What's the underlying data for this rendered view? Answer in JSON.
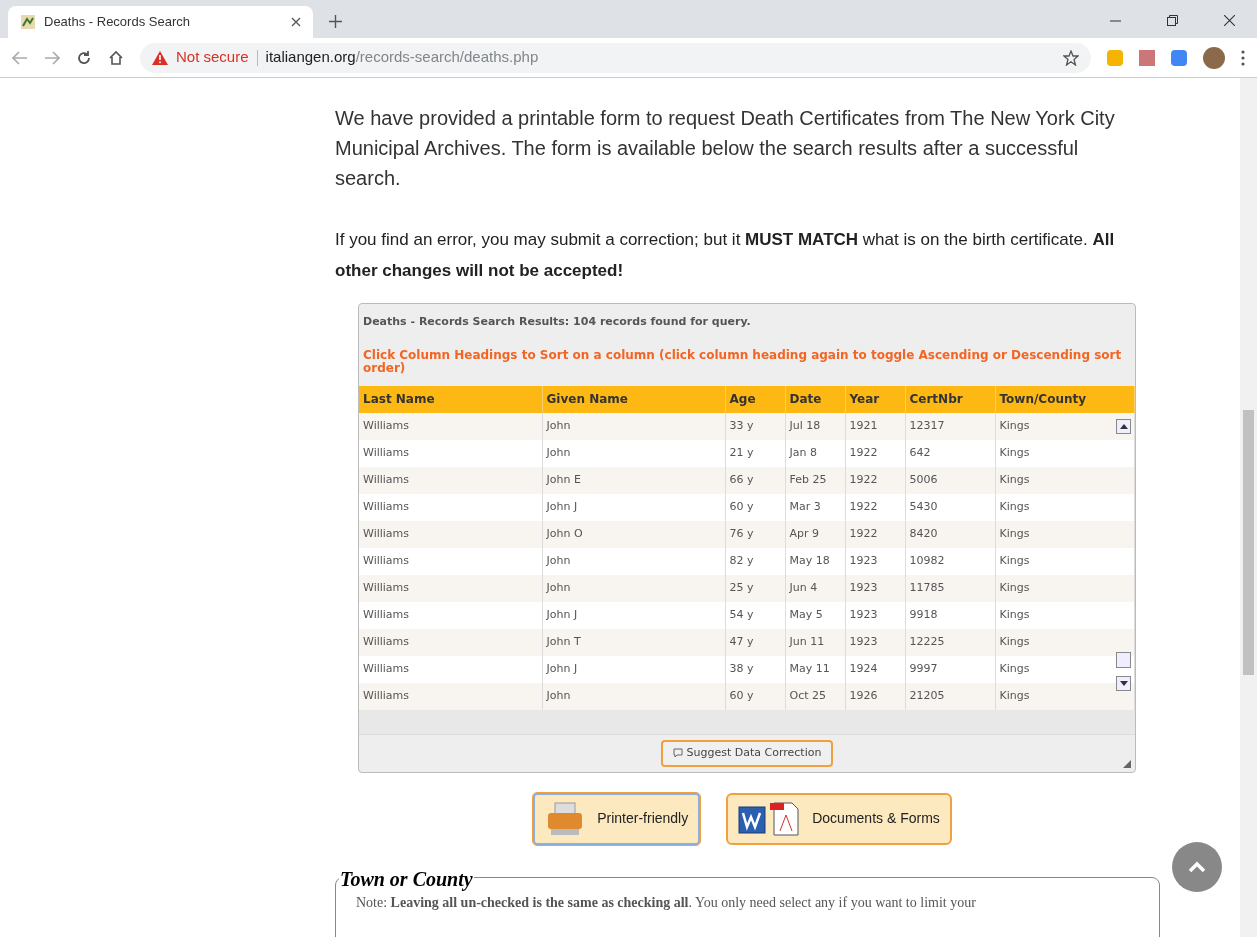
{
  "browser": {
    "tab_title": "Deaths - Records Search",
    "security": "Not secure",
    "url_host": "italiangen.org",
    "url_path": "/records-search/deaths.php"
  },
  "intro": "We have provided a printable form to request Death Certificates from The New York City Municipal Archives. The form is available below the search results after a successful search.",
  "notice": "If you find an error, you may submit a correction; but it **MUST MATCH** what is on the birth certificate. **All other changes will not be accepted!**",
  "results": {
    "summary": "Deaths - Records Search Results: 104 records found for query.",
    "hint": "Click Column Headings to Sort on a column (click column heading again to toggle Ascending or Descending sort order)",
    "columns": [
      "Last Name",
      "Given Name",
      "Age",
      "Date",
      "Year",
      "CertNbr",
      "Town/County"
    ],
    "rows": [
      [
        "Williams",
        "John",
        "33 y",
        "Jul 18",
        "1921",
        "12317",
        "Kings"
      ],
      [
        "Williams",
        "John",
        "21 y",
        "Jan 8",
        "1922",
        "642",
        "Kings"
      ],
      [
        "Williams",
        "John E",
        "66 y",
        "Feb 25",
        "1922",
        "5006",
        "Kings"
      ],
      [
        "Williams",
        "John J",
        "60 y",
        "Mar 3",
        "1922",
        "5430",
        "Kings"
      ],
      [
        "Williams",
        "John O",
        "76 y",
        "Apr 9",
        "1922",
        "8420",
        "Kings"
      ],
      [
        "Williams",
        "John",
        "82 y",
        "May 18",
        "1923",
        "10982",
        "Kings"
      ],
      [
        "Williams",
        "John",
        "25 y",
        "Jun 4",
        "1923",
        "11785",
        "Kings"
      ],
      [
        "Williams",
        "John J",
        "54 y",
        "May 5",
        "1923",
        "9918",
        "Kings"
      ],
      [
        "Williams",
        "John T",
        "47 y",
        "Jun 11",
        "1923",
        "12225",
        "Kings"
      ],
      [
        "Williams",
        "John J",
        "38 y",
        "May 11",
        "1924",
        "9997",
        "Kings"
      ],
      [
        "Williams",
        "John",
        "60 y",
        "Oct 25",
        "1926",
        "21205",
        "Kings"
      ]
    ],
    "correction_button": "Suggest Data Correction"
  },
  "buttons": [
    {
      "kind": "printer",
      "label": "Printer-friendly",
      "selected": true
    },
    {
      "kind": "documents",
      "label": "Documents & Forms",
      "selected": false
    }
  ],
  "town_section": {
    "legend": "Town or County",
    "note": "Note: **Leaving all un-checked is the same as checking all**. You only need select any if you want to limit your"
  }
}
